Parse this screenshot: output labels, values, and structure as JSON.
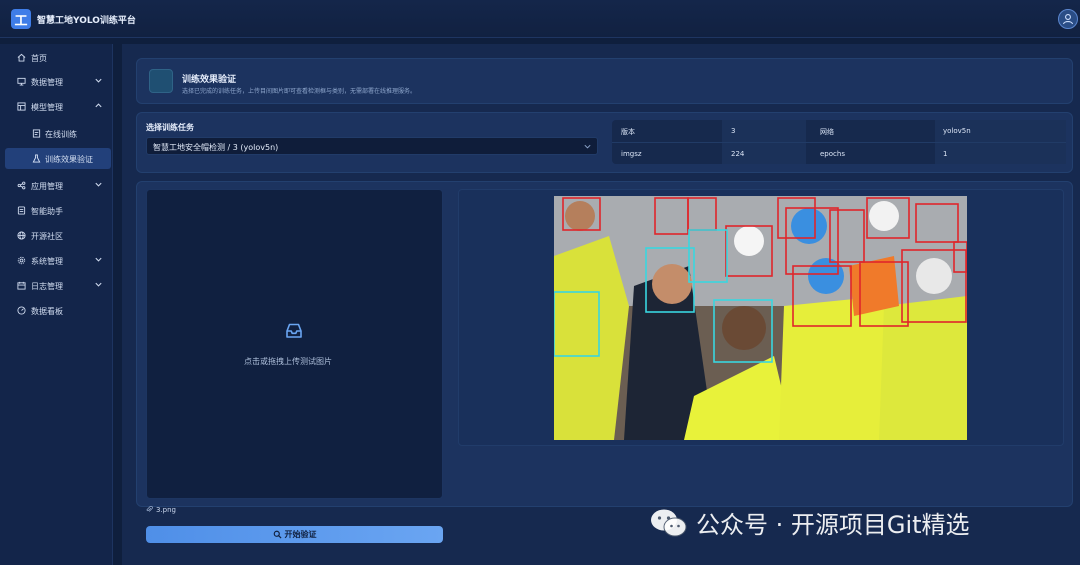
{
  "app": {
    "logo_char": "工",
    "title": "智慧工地YOLO训练平台"
  },
  "sidebar": {
    "items": [
      {
        "label": "首页",
        "icon": "home-icon"
      },
      {
        "label": "数据管理",
        "icon": "monitor-icon",
        "expandable": true
      },
      {
        "label": "模型管理",
        "icon": "model-icon",
        "expandable": true,
        "expanded": true
      },
      {
        "label": "在线训练",
        "icon": "train-icon",
        "sub": true
      },
      {
        "label": "训练效果验证",
        "icon": "flask-icon",
        "sub": true,
        "active": true
      },
      {
        "label": "应用管理",
        "icon": "share-icon",
        "expandable": true
      },
      {
        "label": "智能助手",
        "icon": "assistant-icon"
      },
      {
        "label": "开源社区",
        "icon": "globe-icon"
      },
      {
        "label": "系统管理",
        "icon": "gear-icon",
        "expandable": true
      },
      {
        "label": "日志管理",
        "icon": "calendar-icon",
        "expandable": true
      },
      {
        "label": "数据看板",
        "icon": "dashboard-icon"
      }
    ]
  },
  "header": {
    "title": "训练效果验证",
    "description": "选择已完成的训练任务，上传目间图片即可查看检测框与类别，无需部署在线推理服务。"
  },
  "task": {
    "label": "选择训练任务",
    "selected": "智慧工地安全帽检测 / 3 (yolov5n)"
  },
  "info": {
    "version_label": "版本",
    "version_value": "3",
    "network_label": "网络",
    "network_value": "yolov5n",
    "imgsz_label": "imgsz",
    "imgsz_value": "224",
    "epochs_label": "epochs",
    "epochs_value": "1"
  },
  "upload": {
    "hint": "点击或拖拽上传测试图片"
  },
  "result": {
    "image_description_colors": {
      "box_red": "#e0262b",
      "box_cyan": "#39d6e0"
    }
  },
  "file": {
    "name": "3.png"
  },
  "actions": {
    "start_label": "开始验证"
  },
  "watermark": {
    "text": "公众号 · 开源项目Git精选"
  }
}
